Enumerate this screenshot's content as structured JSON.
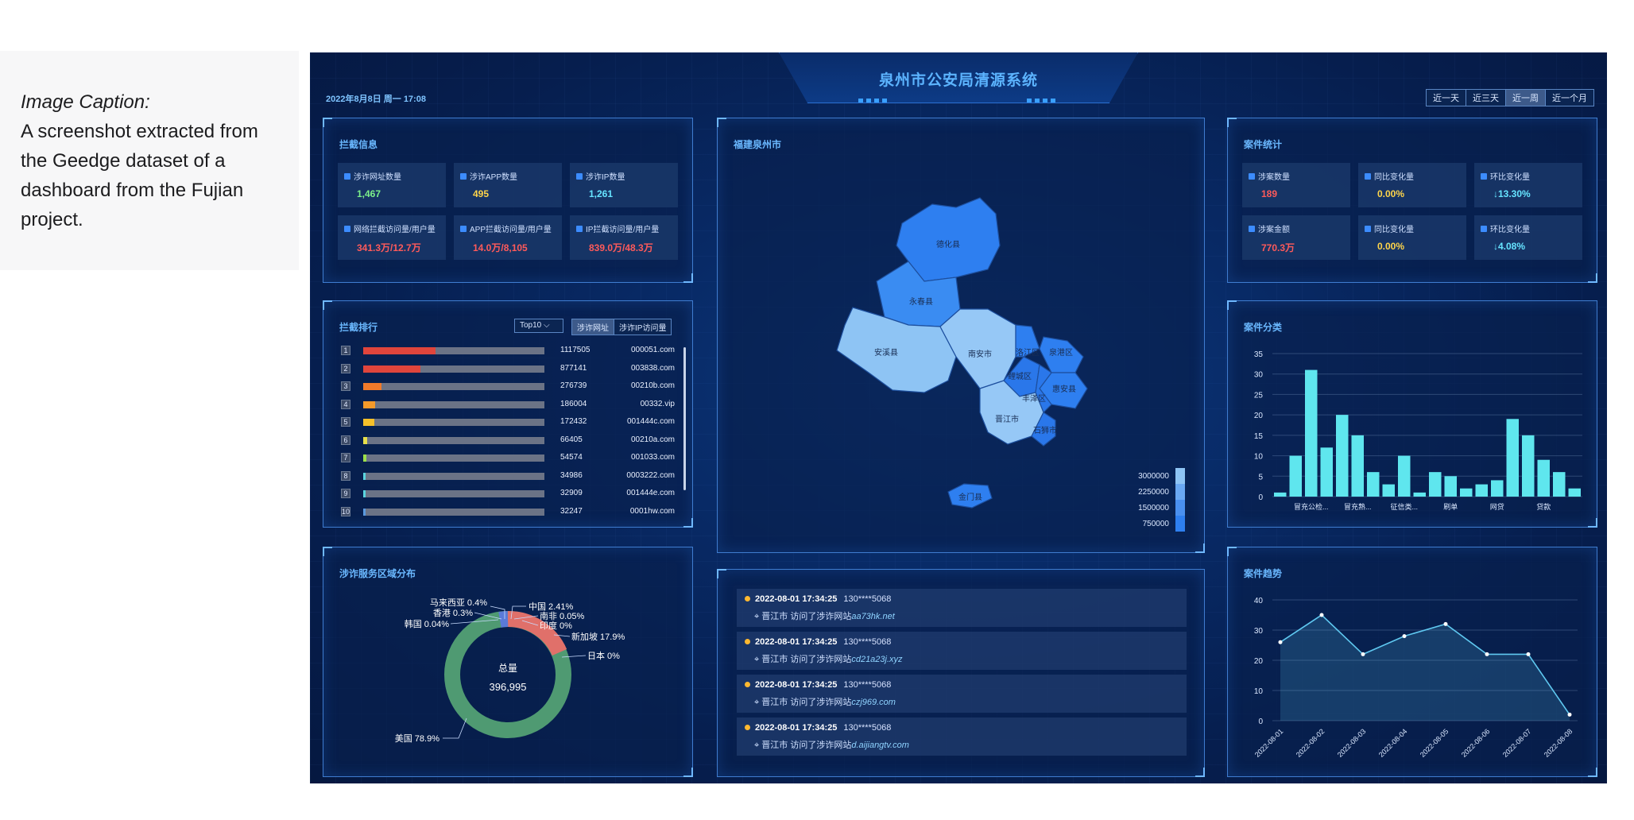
{
  "caption": {
    "title": "Image Caption:",
    "text": "A screenshot extracted from the Geedge dataset of a dashboard from the Fujian project."
  },
  "header": {
    "title": "泉州市公安局清源系统",
    "datetime": "2022年8月8日 周一 17:08",
    "ranges": [
      "近一天",
      "近三天",
      "近一周",
      "近一个月"
    ],
    "active_range": "近一周"
  },
  "intercept_info": {
    "title": "拦截信息",
    "cards": [
      {
        "label": "涉诈网址数量",
        "value": "1,467",
        "color": "green"
      },
      {
        "label": "涉诈APP数量",
        "value": "495",
        "color": "yellow"
      },
      {
        "label": "涉诈IP数量",
        "value": "1,261",
        "color": "cyan"
      },
      {
        "label": "网络拦截访问量/用户量",
        "value": "341.3万/12.7万",
        "color": "red"
      },
      {
        "label": "APP拦截访问量/用户量",
        "value": "14.0万/8,105",
        "color": "red"
      },
      {
        "label": "IP拦截访问量/用户量",
        "value": "839.0万/48.3万",
        "color": "red"
      }
    ]
  },
  "ranking": {
    "title": "拦截排行",
    "top_select": "Top10",
    "tabs": [
      "涉诈网址",
      "涉诈IP访问量"
    ],
    "active_tab": "涉诈网址",
    "rows": [
      {
        "rank": "1",
        "count": "1117505",
        "domain": "000051.com",
        "value": 1117505,
        "color": "#e0453c"
      },
      {
        "rank": "2",
        "count": "877141",
        "domain": "003838.com",
        "value": 877141,
        "color": "#e0453c"
      },
      {
        "rank": "3",
        "count": "276739",
        "domain": "00210b.com",
        "value": 276739,
        "color": "#f07a2a"
      },
      {
        "rank": "4",
        "count": "186004",
        "domain": "00332.vip",
        "value": 186004,
        "color": "#f59a2a"
      },
      {
        "rank": "5",
        "count": "172432",
        "domain": "001444c.com",
        "value": 172432,
        "color": "#f5c02a"
      },
      {
        "rank": "6",
        "count": "66405",
        "domain": "00210a.com",
        "value": 66405,
        "color": "#e8e04a"
      },
      {
        "rank": "7",
        "count": "54574",
        "domain": "001033.com",
        "value": 54574,
        "color": "#9ce04a"
      },
      {
        "rank": "8",
        "count": "34986",
        "domain": "0003222.com",
        "value": 34986,
        "color": "#5ad4e0"
      },
      {
        "rank": "9",
        "count": "32909",
        "domain": "001444e.com",
        "value": 32909,
        "color": "#5ad4e0"
      },
      {
        "rank": "10",
        "count": "32247",
        "domain": "0001hw.com",
        "value": 32247,
        "color": "#5a9ae0"
      }
    ]
  },
  "region": {
    "title": "涉诈服务区域分布",
    "center_label": "总量",
    "center_value": "396,995",
    "labels": [
      "马来西亚 0.4%",
      "中国 2.41%",
      "香港 0.3%",
      "南非 0.05%",
      "韩国 0.04%",
      "印度 0%",
      "新加坡 17.9%",
      "日本 0%",
      "美国 78.9%"
    ]
  },
  "map": {
    "title": "福建泉州市",
    "districts": [
      "德化县",
      "永春县",
      "安溪县",
      "南安市",
      "洛江区",
      "泉港区",
      "惠安县",
      "鲤城区",
      "丰泽区",
      "晋江市",
      "石狮市",
      "金门县"
    ],
    "legend": [
      "3000000",
      "2250000",
      "1500000",
      "750000"
    ]
  },
  "feed": {
    "items": [
      {
        "time": "2022-08-01 17:34:25",
        "phone": "130****5068",
        "city": "晋江市",
        "action": "访问了涉诈网站",
        "url": "aa73hk.net"
      },
      {
        "time": "2022-08-01 17:34:25",
        "phone": "130****5068",
        "city": "晋江市",
        "action": "访问了涉诈网站",
        "url": "cd21a23j.xyz"
      },
      {
        "time": "2022-08-01 17:34:25",
        "phone": "130****5068",
        "city": "晋江市",
        "action": "访问了涉诈网站",
        "url": "czj969.com"
      },
      {
        "time": "2022-08-01 17:34:25",
        "phone": "130****5068",
        "city": "晋江市",
        "action": "访问了涉诈网站",
        "url": "d.aijiangtv.com"
      }
    ]
  },
  "case_stats": {
    "title": "案件统计",
    "cards": [
      {
        "label": "涉案数量",
        "value": "189",
        "color": "red"
      },
      {
        "label": "同比变化量",
        "value": "0.00%",
        "color": "yellow"
      },
      {
        "label": "环比变化量",
        "value": "↓13.30%",
        "color": "cyan"
      },
      {
        "label": "涉案金额",
        "value": "770.3万",
        "color": "red"
      },
      {
        "label": "同比变化量",
        "value": "0.00%",
        "color": "yellow"
      },
      {
        "label": "环比变化量",
        "value": "↓4.08%",
        "color": "cyan"
      }
    ]
  },
  "chart_data": [
    {
      "type": "bar",
      "title": "案件分类",
      "ylim": [
        0,
        35
      ],
      "yticks": [
        0,
        5,
        10,
        15,
        20,
        25,
        30,
        35
      ],
      "category_labels": [
        "冒充公检...",
        "冒充熟...",
        "征信类...",
        "刷单",
        "网贷",
        "贷款"
      ],
      "values": [
        1,
        10,
        31,
        12,
        20,
        15,
        6,
        3,
        10,
        1,
        6,
        5,
        2,
        3,
        4,
        19,
        15,
        9,
        6,
        2
      ],
      "color": "#5fe6ee"
    },
    {
      "type": "line",
      "title": "案件趋势",
      "x": [
        "2022-08-01",
        "2022-08-02",
        "2022-08-03",
        "2022-08-04",
        "2022-08-05",
        "2022-08-06",
        "2022-08-07",
        "2022-08-08"
      ],
      "values": [
        26,
        35,
        22,
        28,
        32,
        22,
        22,
        2
      ],
      "ylim": [
        0,
        40
      ],
      "yticks": [
        0,
        10,
        20,
        30,
        40
      ],
      "color": "#5fc8f0"
    }
  ]
}
